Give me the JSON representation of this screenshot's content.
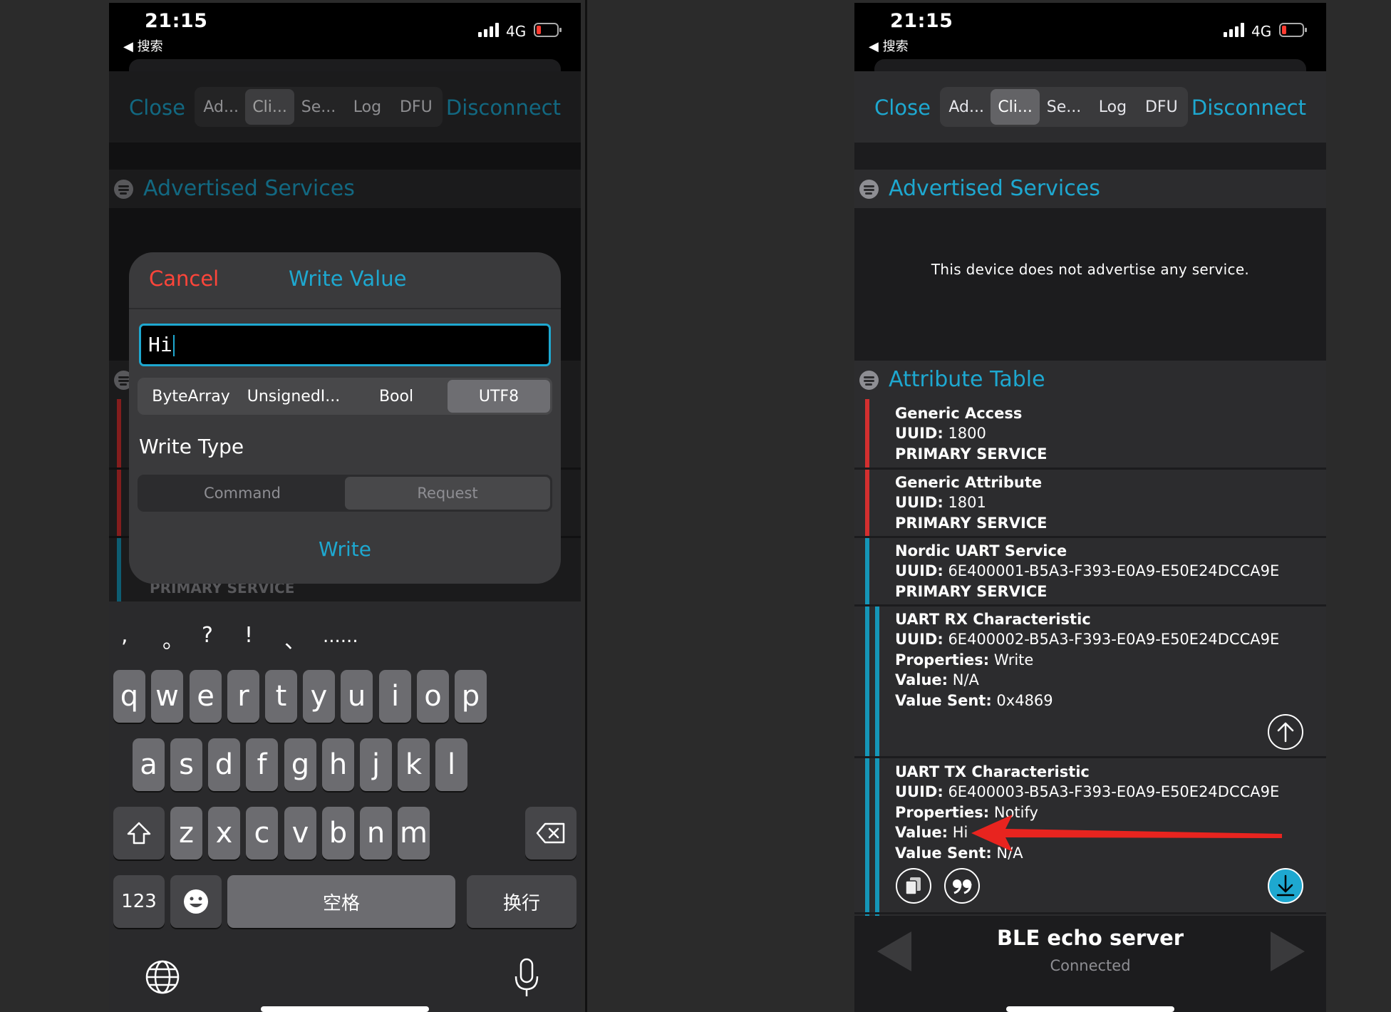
{
  "status_bar": {
    "time": "21:15",
    "back_label": "◀ 搜索",
    "network": "4G"
  },
  "navbar": {
    "close_label": "Close",
    "disconnect_label": "Disconnect",
    "tabs": [
      "Ad...",
      "Cli...",
      "Se...",
      "Log",
      "DFU"
    ],
    "selected_tab": "Cli..."
  },
  "advertised_services": {
    "title": "Advertised Services",
    "empty_message": "This device does not advertise any service."
  },
  "attribute_table": {
    "title": "Attribute Table",
    "services": [
      {
        "name": "Generic Access",
        "uuid_label": "UUID:",
        "uuid": "1800",
        "type": "PRIMARY SERVICE",
        "color": "#d32f2f"
      },
      {
        "name": "Generic Attribute",
        "uuid_label": "UUID:",
        "uuid": "1801",
        "type": "PRIMARY SERVICE",
        "color": "#d32f2f"
      },
      {
        "name": "Nordic UART Service",
        "uuid_label": "UUID:",
        "uuid": "6E400001-B5A3-F393-E0A9-E50E24DCCA9E",
        "type": "PRIMARY SERVICE",
        "color": "#1596b8"
      }
    ],
    "characteristics": [
      {
        "name": "UART RX Characteristic",
        "uuid_label": "UUID:",
        "uuid": "6E400002-B5A3-F393-E0A9-E50E24DCCA9E",
        "properties_label": "Properties:",
        "properties": "Write",
        "value_label": "Value:",
        "value": "N/A",
        "value_sent_label": "Value Sent:",
        "value_sent": "0x4869"
      },
      {
        "name": "UART TX Characteristic",
        "uuid_label": "UUID:",
        "uuid": "6E400003-B5A3-F393-E0A9-E50E24DCCA9E",
        "properties_label": "Properties:",
        "properties": "Notify",
        "value_label": "Value:",
        "value": "Hi",
        "value_sent_label": "Value Sent:",
        "value_sent": "N/A"
      }
    ]
  },
  "left_partial_service_type": "PRIMARY SERVICE",
  "bottom_bar": {
    "device_name": "BLE echo server",
    "status": "Connected"
  },
  "write_dialog": {
    "cancel_label": "Cancel",
    "title": "Write Value",
    "input_value": "Hi",
    "formats": [
      "ByteArray",
      "UnsignedI...",
      "Bool",
      "UTF8"
    ],
    "selected_format": "UTF8",
    "write_type_label": "Write Type",
    "write_types": [
      "Command",
      "Request"
    ],
    "selected_write_type": "Request",
    "write_label": "Write"
  },
  "keyboard": {
    "candidates": [
      ",",
      "。",
      "?",
      "!",
      "、",
      "......"
    ],
    "row1": [
      "q",
      "w",
      "e",
      "r",
      "t",
      "y",
      "u",
      "i",
      "o",
      "p"
    ],
    "row2": [
      "a",
      "s",
      "d",
      "f",
      "g",
      "h",
      "j",
      "k",
      "l"
    ],
    "row3": [
      "z",
      "x",
      "c",
      "v",
      "b",
      "n",
      "m"
    ],
    "numbers_label": "123",
    "space_label": "空格",
    "return_label": "换行"
  },
  "colors": {
    "accent": "#1ea8d0",
    "destructive": "#ff453a",
    "service_red": "#d32f2f",
    "service_blue": "#1596b8",
    "annotation_arrow": "#e8241f"
  }
}
